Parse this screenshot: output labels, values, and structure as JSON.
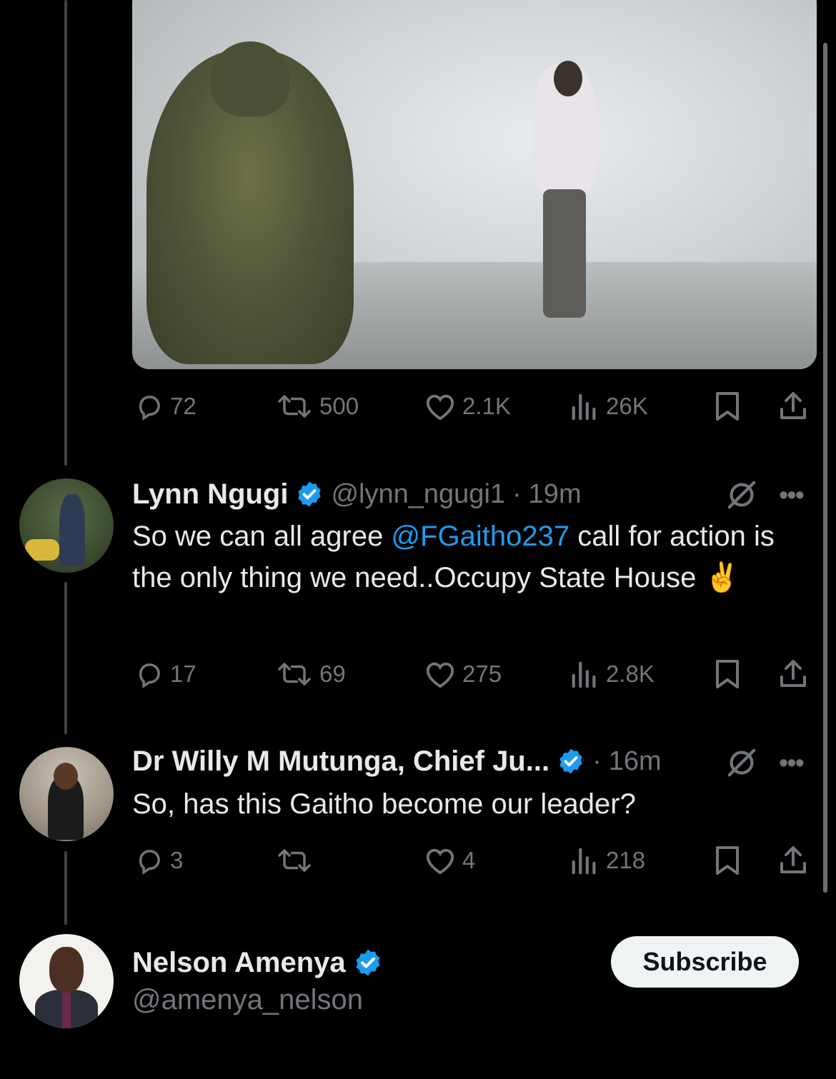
{
  "tweet_main": {
    "stats": {
      "replies": "72",
      "reposts": "500",
      "likes": "2.1K",
      "views": "26K"
    }
  },
  "reply1": {
    "name": "Lynn Ngugi",
    "handle": "@lynn_ngugi1",
    "sep": "·",
    "time": "19m",
    "text_before": "So we can all agree ",
    "mention": "@FGaitho237",
    "text_after": " call for action is the only thing we need..Occupy State House ✌️",
    "stats": {
      "replies": "17",
      "reposts": "69",
      "likes": "275",
      "views": "2.8K"
    }
  },
  "reply2": {
    "name": "Dr Willy M Mutunga, Chief Ju...",
    "sep": "·",
    "time": "16m",
    "text": "So, has this Gaitho become our leader?",
    "stats": {
      "replies": "3",
      "reposts": "",
      "likes": "4",
      "views": "218"
    }
  },
  "profile": {
    "name": "Nelson Amenya",
    "handle": "@amenya_nelson",
    "subscribe_label": "Subscribe"
  },
  "colors": {
    "accent": "#1d9bf0",
    "muted": "#71767b",
    "background": "#000000",
    "text": "#e7e9ea"
  },
  "icons": [
    "reply-icon",
    "repost-icon",
    "like-icon",
    "views-icon",
    "bookmark-icon",
    "share-icon",
    "verified-badge-icon",
    "grok-slash-icon",
    "more-icon"
  ]
}
